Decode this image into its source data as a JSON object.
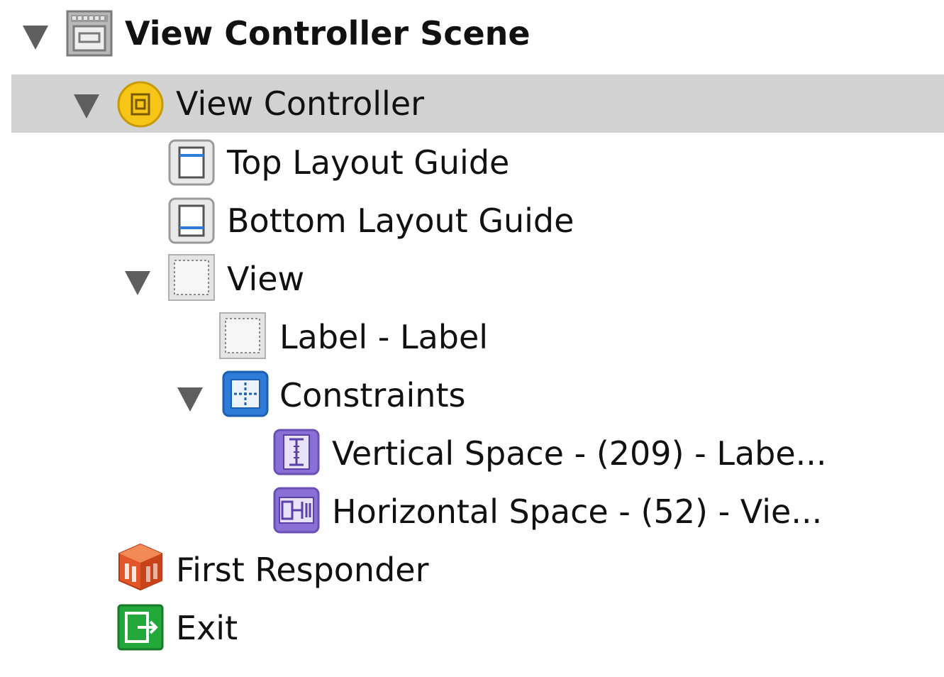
{
  "outline": {
    "scene": {
      "label": "View Controller Scene",
      "icon": "scene-icon",
      "expanded": true
    },
    "items": [
      {
        "label": "View Controller",
        "icon": "view-controller-icon",
        "expanded": true,
        "selected": true
      },
      {
        "label": "Top Layout Guide",
        "icon": "top-layout-guide-icon"
      },
      {
        "label": "Bottom Layout Guide",
        "icon": "bottom-layout-guide-icon"
      },
      {
        "label": "View",
        "icon": "view-icon",
        "expanded": true
      },
      {
        "label": "Label - Label",
        "icon": "label-icon"
      },
      {
        "label": "Constraints",
        "icon": "constraints-icon",
        "expanded": true
      },
      {
        "label": "Vertical Space - (209) - Labe...",
        "icon": "vertical-space-icon"
      },
      {
        "label": "Horizontal Space - (52) - Vie...",
        "icon": "horizontal-space-icon"
      },
      {
        "label": "First Responder",
        "icon": "first-responder-icon"
      },
      {
        "label": "Exit",
        "icon": "exit-icon"
      }
    ]
  },
  "colors": {
    "selection": "#d2d2d2",
    "disclosure": "#5e5e5e",
    "view_controller_icon": "#f5c518",
    "constraints_icon": "#2f7bd8",
    "constraint_item_icon": "#8a6fd6",
    "first_responder_icon": "#e2572a",
    "exit_icon": "#22a83a"
  }
}
